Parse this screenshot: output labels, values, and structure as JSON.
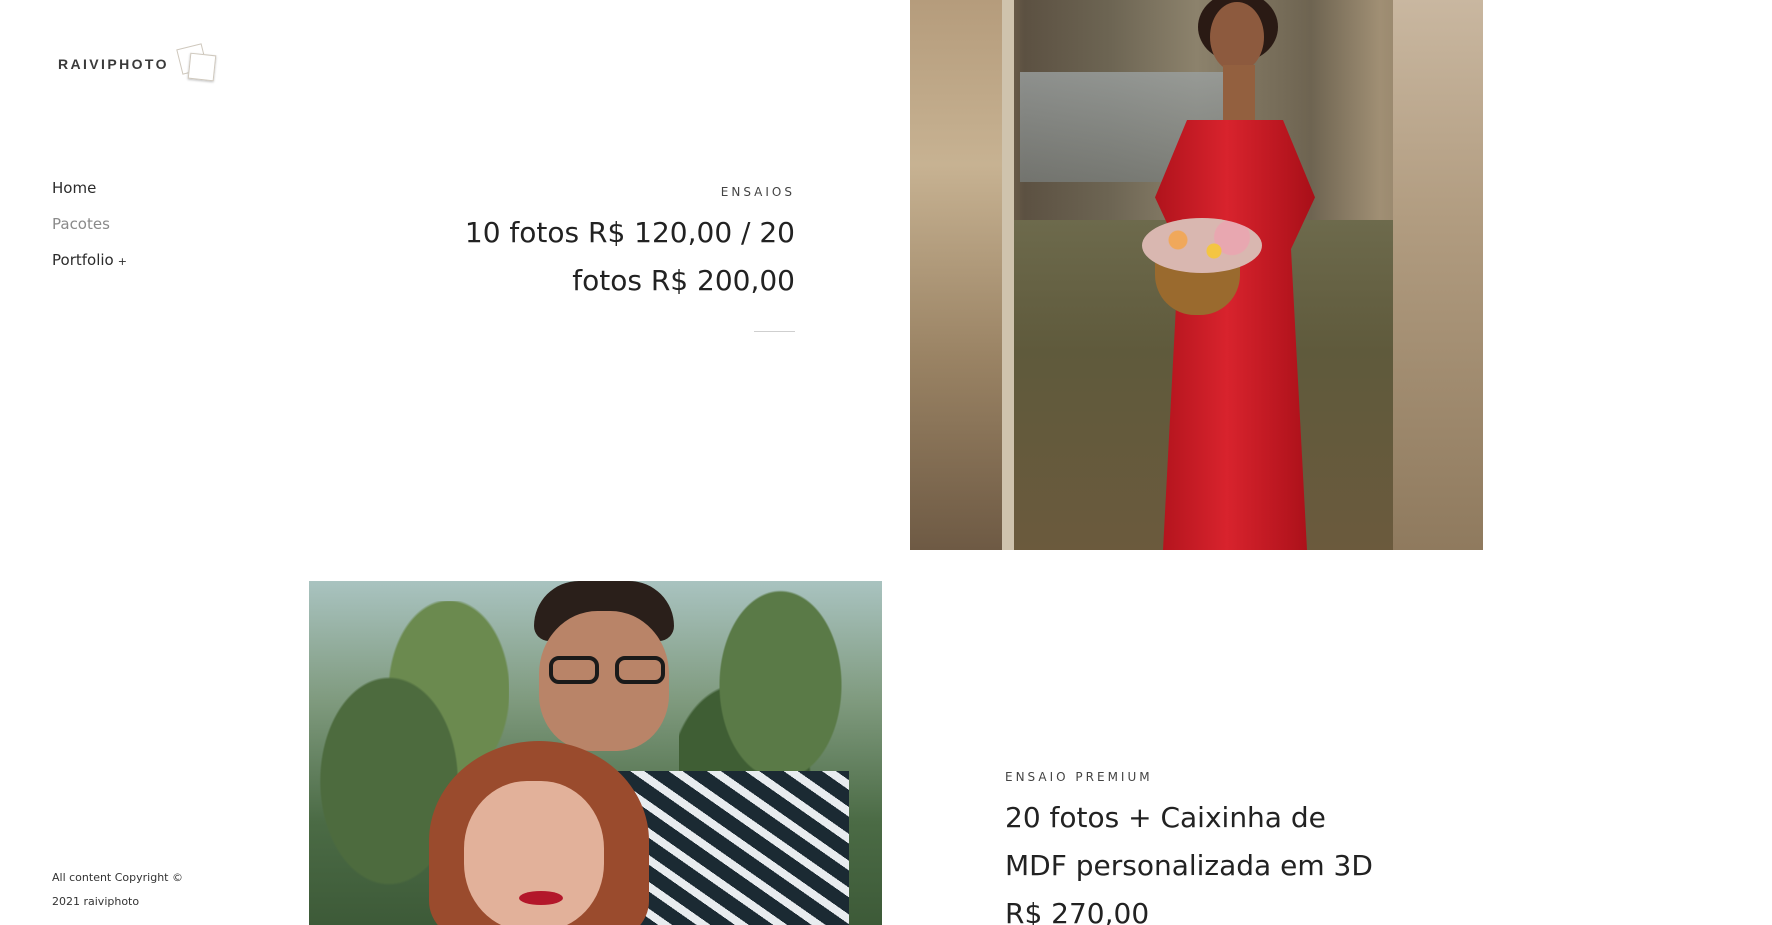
{
  "brand": {
    "name": "RAIVIPHOTO"
  },
  "nav": {
    "items": [
      {
        "label": "Home"
      },
      {
        "label": "Pacotes"
      },
      {
        "label": "Portfolio",
        "suffix": "+"
      }
    ]
  },
  "footer": {
    "copyright_line1": "All content Copyright ©",
    "copyright_line2": "2021 raiviphoto"
  },
  "packages": [
    {
      "category": "ENSAIOS",
      "title_line1": "10 fotos R$ 120,00 / 20",
      "title_line2": "fotos R$ 200,00"
    },
    {
      "category": "ENSAIO PREMIUM",
      "title_line1": "20 fotos + Caixinha de",
      "title_line2": "MDF personalizada em 3D",
      "title_line3": "R$ 270,00"
    }
  ],
  "colors": {
    "text": "#2b2b2b",
    "muted": "#8a8a8a",
    "background": "#ffffff",
    "dress_red": "#d8232d"
  },
  "icons": {
    "logo": "polaroid-stack-icon"
  }
}
